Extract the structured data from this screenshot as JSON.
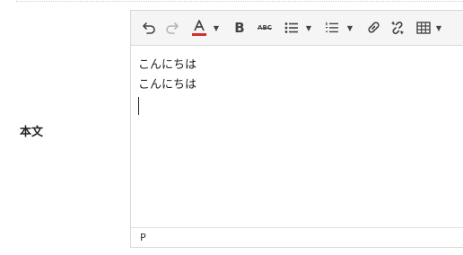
{
  "form": {
    "field_label": "本文"
  },
  "toolbar": {
    "items": [
      {
        "name": "undo-icon"
      },
      {
        "name": "redo-icon"
      },
      {
        "name": "text-color-icon",
        "accent": "#d32f2f"
      },
      {
        "name": "bold-icon",
        "label": "B"
      },
      {
        "name": "strikethrough-icon",
        "label": "ABC"
      },
      {
        "name": "bullet-list-icon"
      },
      {
        "name": "numbered-list-icon"
      },
      {
        "name": "link-icon"
      },
      {
        "name": "unlink-icon"
      },
      {
        "name": "table-icon"
      }
    ]
  },
  "editor": {
    "lines": [
      "こんにちは",
      "こんにちは"
    ]
  },
  "statusbar": {
    "path": "P"
  }
}
